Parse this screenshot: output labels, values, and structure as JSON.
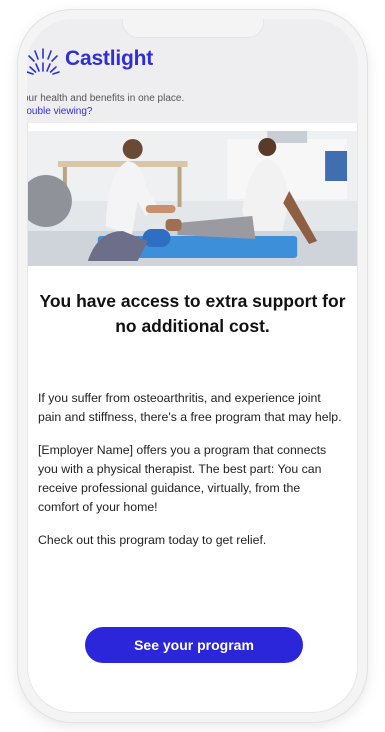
{
  "brand": {
    "name": "Castlight",
    "color": "#2f2fd6"
  },
  "header": {
    "tagline": "our health and benefits in one place.",
    "trouble_link": "rouble viewing?"
  },
  "hero": {
    "icon": "physical-therapy-photo"
  },
  "content": {
    "headline": "You have access to extra support for no additional cost.",
    "paragraphs": [
      "If you suffer from osteoarthritis, and experience joint pain and stiffness, there's a free program that may help.",
      "[Employer Name] offers you a program that connects you with a physical therapist. The best part: You can receive professional guidance, virtually, from the comfort of your home!",
      "Check out this program today to get relief."
    ]
  },
  "cta": {
    "label": "See your program",
    "color": "#2b26d9"
  }
}
